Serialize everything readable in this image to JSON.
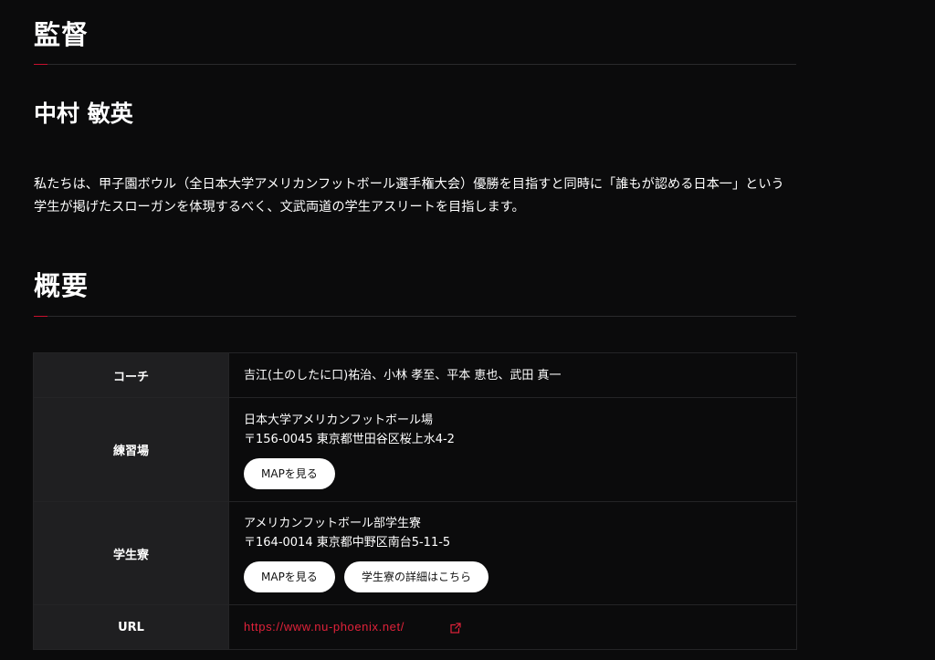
{
  "director": {
    "heading": "監督",
    "name": "中村 敏英",
    "message": "私たちは、甲子園ボウル（全日本大学アメリカンフットボール選手権大会）優勝を目指すと同時に「誰もが認める日本一」という学生が掲げたスローガンを体現するべく、文武両道の学生アスリートを目指します。"
  },
  "overview": {
    "heading": "概要",
    "rows": {
      "coach": {
        "label": "コーチ",
        "value": "吉江(土のしたに口)祐治、小林 孝至、平本 恵也、武田 真一"
      },
      "practice": {
        "label": "練習場",
        "venue": "日本大学アメリカンフットボール場",
        "address": "〒156-0045 東京都世田谷区桜上水4-2",
        "map_button": "MAPを見る"
      },
      "dorm": {
        "label": "学生寮",
        "venue": "アメリカンフットボール部学生寮",
        "address": "〒164-0014 東京都中野区南台5-11-5",
        "map_button": "MAPを見る",
        "detail_button": "学生寮の詳細はこちら"
      },
      "url": {
        "label": "URL",
        "link_text": "https://www.nu-phoenix.net/",
        "icon": "external-link-icon"
      }
    }
  },
  "colors": {
    "background": "#0b0b0c",
    "accent": "#c8102e",
    "link": "#e0223a",
    "label_cell": "#1f1f21"
  }
}
